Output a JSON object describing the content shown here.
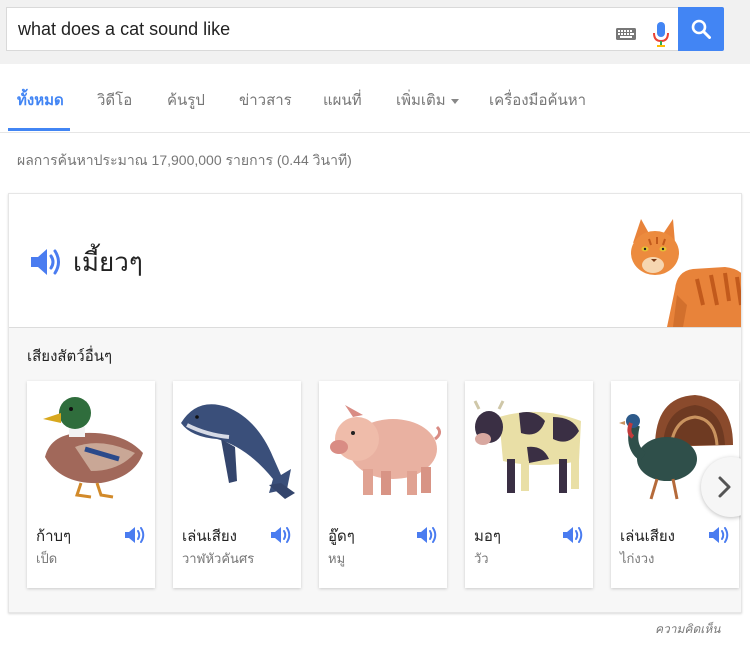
{
  "search": {
    "query": "what does a cat sound like"
  },
  "colors": {
    "accent": "#4285f4",
    "speaker": "#4a7cf0"
  },
  "tabs": [
    {
      "label": "ทั้งหมด",
      "active": true
    },
    {
      "label": "วิดีโอ"
    },
    {
      "label": "ค้นรูป"
    },
    {
      "label": "ข่าวสาร"
    },
    {
      "label": "แผนที่"
    },
    {
      "label": "เพิ่มเติม"
    },
    {
      "label": "เครื่องมือค้นหา"
    }
  ],
  "stats": "ผลการค้นหาประมาณ 17,900,000 รายการ (0.44 วินาที)",
  "answer": {
    "title": "เมี้ยวๆ"
  },
  "other_sounds": {
    "label": "เสียงสัตว์อื่นๆ",
    "items": [
      {
        "name": "ก้าบๆ",
        "animal": "เป็ด"
      },
      {
        "name": "เล่นเสียง",
        "animal": "วาฬหัวคันศร"
      },
      {
        "name": "อู๊ดๆ",
        "animal": "หมู"
      },
      {
        "name": "มอๆ",
        "animal": "วัว"
      },
      {
        "name": "เล่นเสียง",
        "animal": "ไก่งวง"
      }
    ]
  },
  "feedback": "ความคิดเห็น"
}
